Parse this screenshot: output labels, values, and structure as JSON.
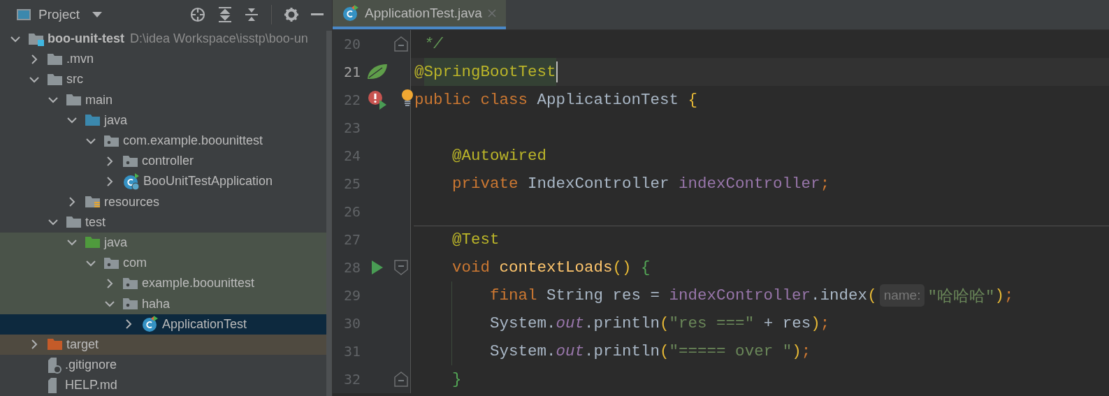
{
  "project_panel": {
    "title": "Project",
    "tree": [
      {
        "label": "boo-unit-test",
        "path": "D:\\idea Workspace\\isstp\\boo-un",
        "kind": "module",
        "expanded": true,
        "selected": false,
        "children": [
          {
            "label": ".mvn",
            "kind": "folder",
            "expanded": false,
            "selected": false
          },
          {
            "label": "src",
            "kind": "folder",
            "expanded": true,
            "selected": false,
            "children": [
              {
                "label": "main",
                "kind": "folder",
                "expanded": true,
                "selected": false,
                "children": [
                  {
                    "label": "java",
                    "kind": "source",
                    "expanded": true,
                    "selected": false,
                    "children": [
                      {
                        "label": "com.example.boounittest",
                        "kind": "package",
                        "expanded": true,
                        "selected": false,
                        "children": [
                          {
                            "label": "controller",
                            "kind": "package",
                            "expanded": false,
                            "selected": false
                          },
                          {
                            "label": "BooUnitTestApplication",
                            "kind": "spring-class",
                            "expanded": false,
                            "selected": false
                          }
                        ]
                      }
                    ]
                  },
                  {
                    "label": "resources",
                    "kind": "resources",
                    "expanded": false,
                    "selected": false
                  }
                ]
              },
              {
                "label": "test",
                "kind": "folder",
                "expanded": true,
                "selected": false,
                "children": [
                  {
                    "label": "java",
                    "kind": "test-source",
                    "test_scope": true,
                    "expanded": true,
                    "selected": false,
                    "children": [
                      {
                        "label": "com",
                        "kind": "package",
                        "test_scope": true,
                        "expanded": true,
                        "selected": false,
                        "children": [
                          {
                            "label": "example.boounittest",
                            "kind": "package",
                            "test_scope": true,
                            "expanded": false,
                            "selected": false
                          },
                          {
                            "label": "haha",
                            "kind": "package",
                            "test_scope": true,
                            "expanded": true,
                            "selected": false,
                            "children": [
                              {
                                "label": "ApplicationTest",
                                "kind": "test-class",
                                "test_scope": true,
                                "expanded": false,
                                "selected": true
                              }
                            ]
                          }
                        ]
                      }
                    ]
                  }
                ]
              }
            ]
          },
          {
            "label": "target",
            "kind": "excluded",
            "excluded": true,
            "expanded": false,
            "selected": false
          },
          {
            "label": ".gitignore",
            "kind": "ignore-file",
            "selected": false
          },
          {
            "label": "HELP.md",
            "kind": "markdown-file",
            "selected": false
          }
        ]
      }
    ]
  },
  "editor": {
    "tabs": [
      {
        "label": "ApplicationTest.java",
        "selected": true
      }
    ],
    "lines": [
      {
        "number": "20",
        "fold": {
          "kind": "end"
        },
        "tokens": [
          {
            "text": " */",
            "kind": "comment"
          }
        ]
      },
      {
        "number": "21",
        "current": true,
        "caret": true,
        "gutter_marker": {
          "kind": "spring"
        },
        "tokens": [
          {
            "text": "@",
            "kind": "ann"
          },
          {
            "text": "SpringBootTest",
            "kind": "ann",
            "highlight": true
          }
        ]
      },
      {
        "number": "22",
        "gutter_marker": {
          "kind": "error-run"
        },
        "bulb": true,
        "tokens": [
          {
            "text": "public",
            "kind": "kw"
          },
          {
            "text": " class",
            "kind": "kw"
          },
          {
            "text": " ApplicationTest",
            "kind": "id"
          },
          {
            "text": " {",
            "kind": "paren"
          }
        ]
      },
      {
        "number": "23"
      },
      {
        "number": "24",
        "tokens": [
          {
            "text": "    @Autowired",
            "kind": "ann"
          }
        ]
      },
      {
        "number": "25",
        "tokens": [
          {
            "text": "    private",
            "kind": "kw"
          },
          {
            "text": " IndexController",
            "kind": "id"
          },
          {
            "text": " indexController",
            "kind": "field"
          },
          {
            "text": ";",
            "kind": "semi"
          }
        ]
      },
      {
        "number": "26"
      },
      {
        "number": "27",
        "separator_above": true,
        "tokens": [
          {
            "text": "    @Test",
            "kind": "ann"
          }
        ]
      },
      {
        "number": "28",
        "gutter_marker": {
          "kind": "run"
        },
        "fold": {
          "kind": "start"
        },
        "tokens": [
          {
            "text": "    void",
            "kind": "kw"
          },
          {
            "text": " contextLoads",
            "kind": "method"
          },
          {
            "text": "()",
            "kind": "paren"
          },
          {
            "text": " {",
            "kind": "brace"
          }
        ]
      },
      {
        "number": "29",
        "tokens": [
          {
            "text": "        final",
            "kind": "kw"
          },
          {
            "text": " String res =",
            "kind": "id"
          },
          {
            "text": " indexController",
            "kind": "field"
          },
          {
            "text": ".index",
            "kind": "id"
          },
          {
            "text": "(",
            "kind": "paren"
          },
          {
            "text": "name:",
            "kind": "hint"
          },
          {
            "text": "\"哈哈哈\"",
            "kind": "str"
          },
          {
            "text": ")",
            "kind": "paren"
          },
          {
            "text": ";",
            "kind": "semi"
          }
        ]
      },
      {
        "number": "30",
        "tokens": [
          {
            "text": "        System.",
            "kind": "id"
          },
          {
            "text": "out",
            "kind": "static"
          },
          {
            "text": ".println",
            "kind": "id"
          },
          {
            "text": "(",
            "kind": "paren"
          },
          {
            "text": "\"res ===\"",
            "kind": "str"
          },
          {
            "text": " + res",
            "kind": "id"
          },
          {
            "text": ")",
            "kind": "paren"
          },
          {
            "text": ";",
            "kind": "semi"
          }
        ]
      },
      {
        "number": "31",
        "tokens": [
          {
            "text": "        System.",
            "kind": "id"
          },
          {
            "text": "out",
            "kind": "static"
          },
          {
            "text": ".println",
            "kind": "id"
          },
          {
            "text": "(",
            "kind": "paren"
          },
          {
            "text": "\"===== over \"",
            "kind": "str"
          },
          {
            "text": ")",
            "kind": "paren"
          },
          {
            "text": ";",
            "kind": "semi"
          }
        ]
      },
      {
        "number": "32",
        "fold": {
          "kind": "end"
        },
        "tokens": [
          {
            "text": "    }",
            "kind": "brace"
          }
        ]
      }
    ]
  }
}
